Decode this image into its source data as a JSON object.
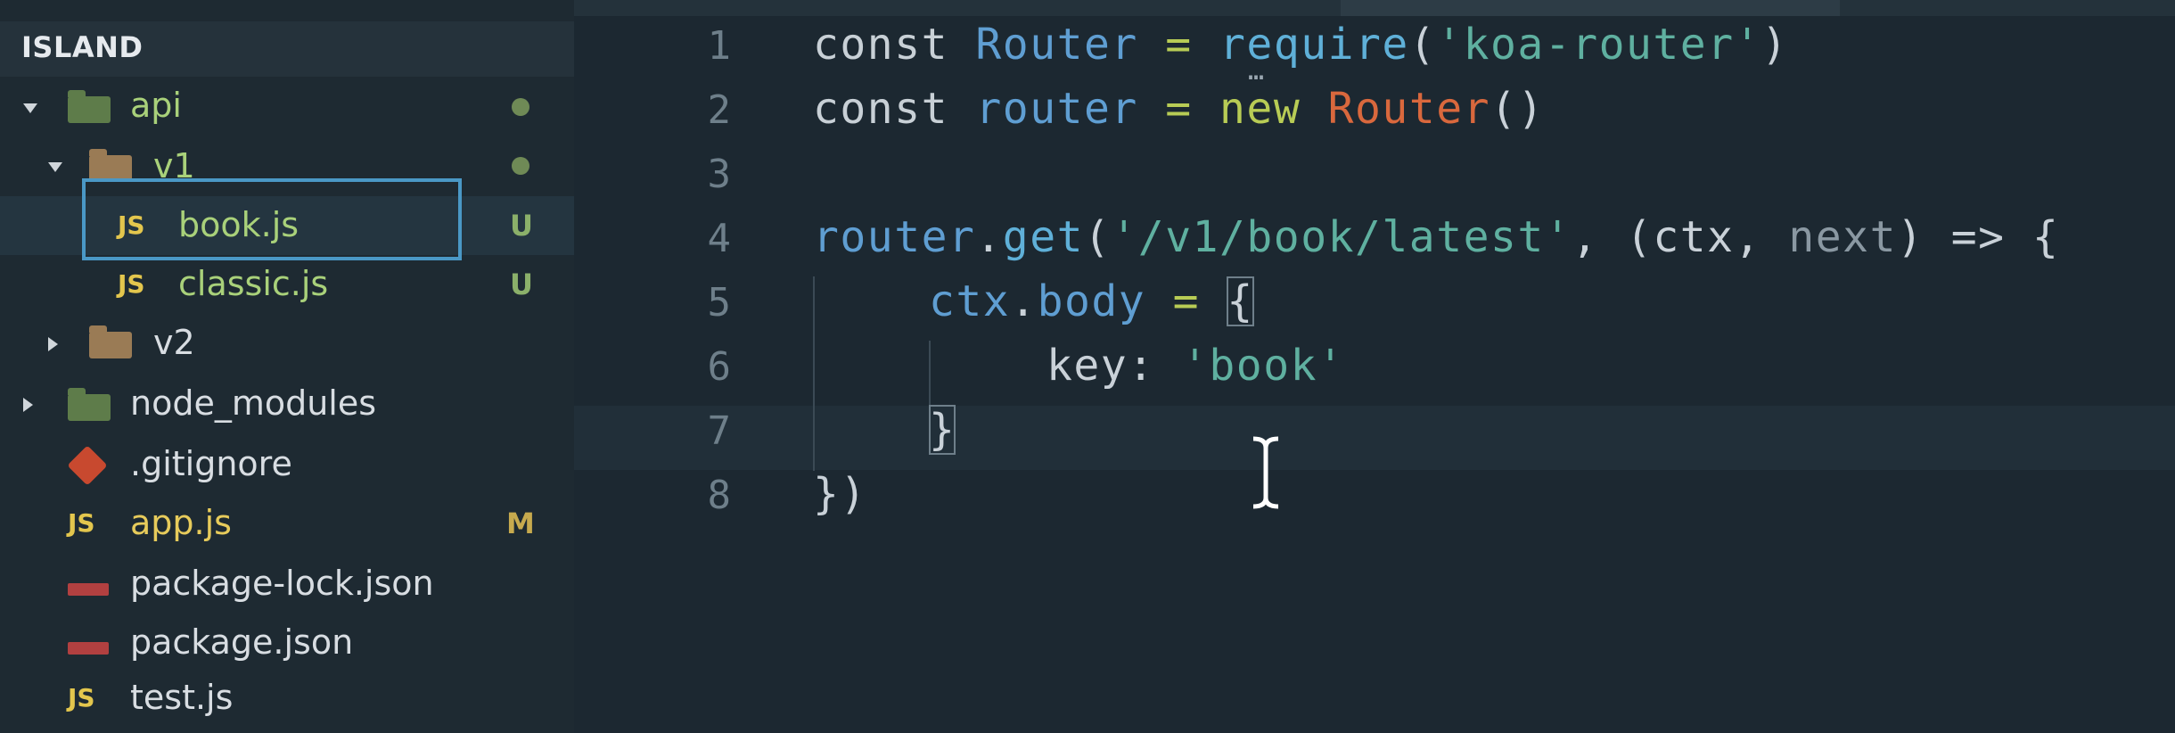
{
  "sidebar": {
    "project_title": "ISLAND",
    "tree": [
      {
        "label": "api",
        "icon": "folder-icon",
        "status": "",
        "has_dot": true
      },
      {
        "label": "v1",
        "icon": "folder-icon",
        "status": "",
        "has_dot": true
      },
      {
        "label": "book.js",
        "icon": "js-file-icon",
        "icon_text": "JS",
        "status": "U",
        "selected": true
      },
      {
        "label": "classic.js",
        "icon": "js-file-icon",
        "icon_text": "JS",
        "status": "U"
      },
      {
        "label": "v2",
        "icon": "folder-icon",
        "status": ""
      },
      {
        "label": "node_modules",
        "icon": "node-folder-icon",
        "status": ""
      },
      {
        "label": ".gitignore",
        "icon": "git-icon",
        "status": ""
      },
      {
        "label": "app.js",
        "icon": "js-file-icon",
        "icon_text": "JS",
        "status": "M"
      },
      {
        "label": "package-lock.json",
        "icon": "npm-icon",
        "status": ""
      },
      {
        "label": "package.json",
        "icon": "npm-icon",
        "status": ""
      },
      {
        "label": "test.js",
        "icon": "js-file-icon",
        "icon_text": "JS",
        "status": ""
      }
    ]
  },
  "editor": {
    "line_numbers": [
      "1",
      "2",
      "3",
      "4",
      "5",
      "6",
      "7",
      "8"
    ],
    "ellipsis": "…",
    "code": {
      "l1": {
        "kw": "const",
        "name": "Router",
        "op": "=",
        "fn": "require",
        "p1": "(",
        "str": "'koa-router'",
        "p2": ")"
      },
      "l2": {
        "kw": "const",
        "name": "router",
        "op": "=",
        "kw2": "new",
        "cls": "Router",
        "parens": "()"
      },
      "l4": {
        "obj": "router",
        "dot": ".",
        "fn": "get",
        "p1": "(",
        "str": "'/v1/book/latest'",
        "comma": ", ",
        "args": "(ctx, ",
        "arg2": "next",
        "p2": ") ",
        "arrow": "=>",
        "brace": " {"
      },
      "l5": {
        "obj": "ctx",
        "dot": ".",
        "prop": "body",
        "op": " = ",
        "brace": "{"
      },
      "l6": {
        "key": "key:",
        "str": "'book'"
      },
      "l7": {
        "brace": "}"
      },
      "l8": {
        "close": "})"
      }
    }
  },
  "colors": {
    "keyword": "#c8d0d6",
    "variable": "#5f9ed2",
    "function": "#5fb0d8",
    "string": "#5fb0a0",
    "class": "#d9683d",
    "new_kw": "#b8cc55",
    "operator": "#b8cc55"
  }
}
